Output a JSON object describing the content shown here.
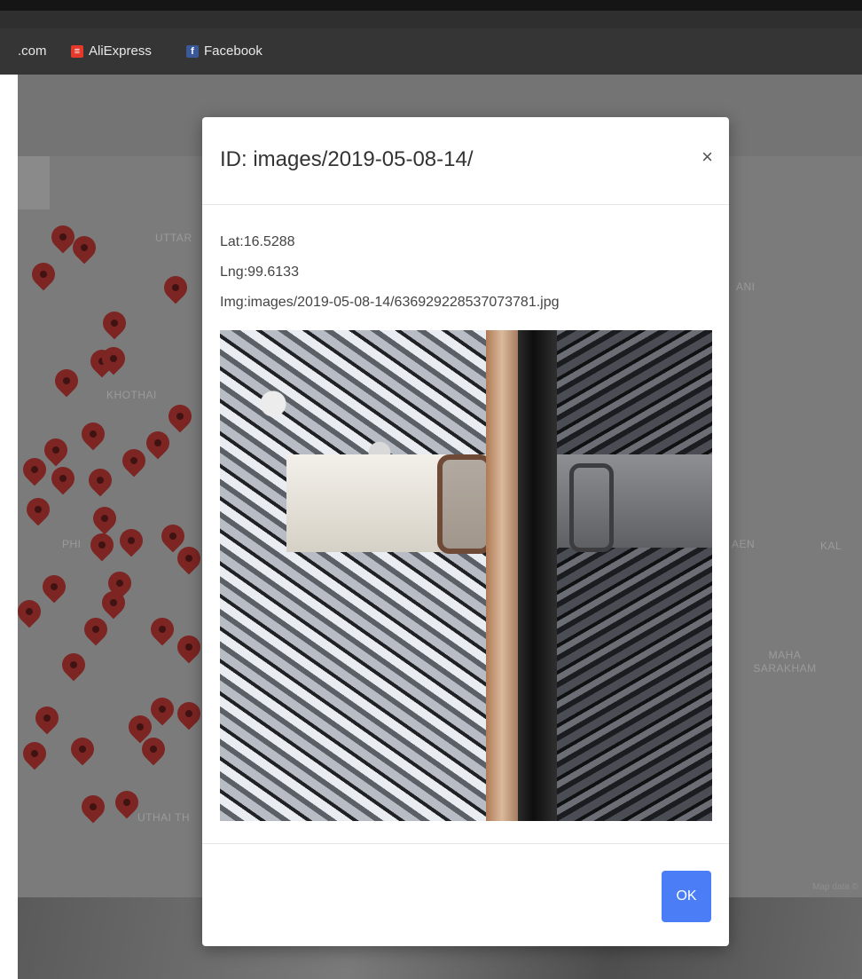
{
  "bookmarks": [
    {
      "label": ".com",
      "icon": "none"
    },
    {
      "label": "AliExpress",
      "icon": "aliexpress-icon"
    },
    {
      "label": "Facebook",
      "icon": "facebook-icon"
    }
  ],
  "map": {
    "labels": [
      "UTTAR",
      "KHOTHAI",
      "PHI",
      "UTHAI TH",
      "ANI",
      "AEN",
      "KAL",
      "MAHA SARAKHAM"
    ],
    "attribution": "Map data ©",
    "pin_color": "#7d2522"
  },
  "modal": {
    "title": "ID: images/2019-05-08-14/",
    "close_glyph": "×",
    "lat": "Lat:16.5288",
    "lng": "Lng:99.6133",
    "img": "Img:images/2019-05-08-14/636929228537073781.jpg",
    "ok_label": "OK",
    "accent": "#4a7df6"
  }
}
